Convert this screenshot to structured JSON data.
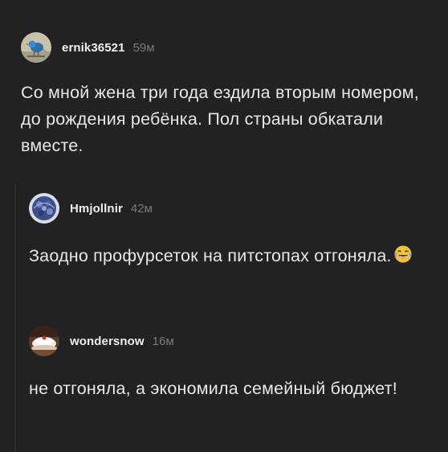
{
  "comments": [
    {
      "username": "ernik36521",
      "time": "59м",
      "text": "Со мной жена три года ездила вторым номером, до рождения ребёнка.  Пол страны обкатали вместе.",
      "avatar_icon": "bird-avatar-icon"
    },
    {
      "username": "Hmjollnir",
      "time": "42м",
      "text": "Заодно профурсеток на питстопах отгоняла.",
      "emoji": "face-with-tears-of-joy-icon",
      "avatar_icon": "blue-pattern-avatar-icon"
    },
    {
      "username": "wondersnow",
      "time": "16м",
      "text": "не отгоняла, а экономила семейный бюджет!",
      "avatar_icon": "cake-avatar-icon"
    }
  ],
  "colors": {
    "background": "#222224",
    "text": "#e8e8e8",
    "username": "#f0f0f0",
    "time": "#7a7a7e"
  }
}
